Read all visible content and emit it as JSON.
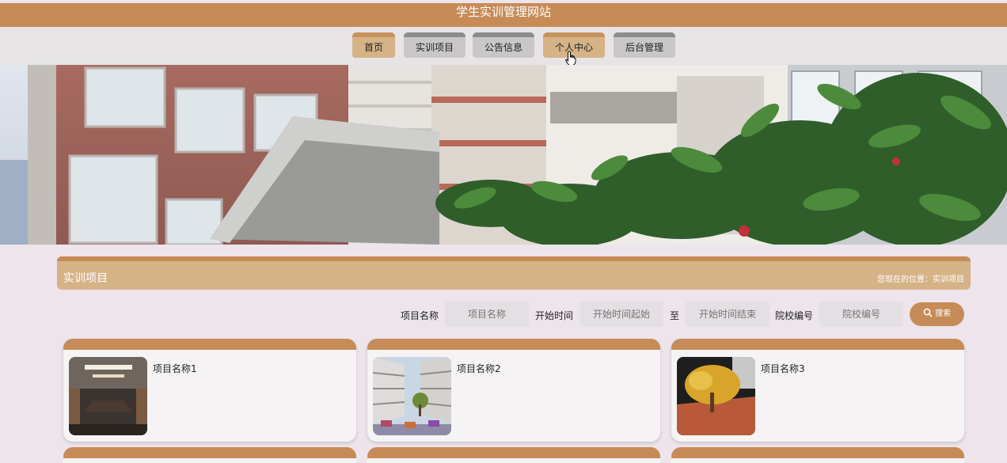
{
  "site": {
    "title": "学生实训管理网站"
  },
  "nav": {
    "items": [
      {
        "label": "首页",
        "state": "active"
      },
      {
        "label": "实训项目",
        "state": "normal"
      },
      {
        "label": "公告信息",
        "state": "normal"
      },
      {
        "label": "个人中心",
        "state": "hover"
      },
      {
        "label": "后台管理",
        "state": "normal"
      }
    ]
  },
  "section": {
    "title": "实训项目",
    "breadcrumb": "您现在的位置：实训项目"
  },
  "search": {
    "name_label": "项目名称",
    "name_placeholder": "项目名称",
    "start_label": "开始时间",
    "start_from_placeholder": "开始时间起始",
    "range_sep": "至",
    "start_to_placeholder": "开始时间结束",
    "school_label": "院校编号",
    "school_placeholder": "院校编号",
    "button_label": "搜索",
    "button_icon": "search-icon"
  },
  "cards": [
    {
      "title": "项目名称1",
      "image": "conference-room"
    },
    {
      "title": "项目名称2",
      "image": "campus-courtyard"
    },
    {
      "title": "项目名称3",
      "image": "autumn-tree"
    }
  ],
  "colors": {
    "accent": "#c68b56",
    "accent_light": "#d6b287",
    "nav_bg": "#e6e4e4",
    "page_bg": "#ede4ec"
  }
}
